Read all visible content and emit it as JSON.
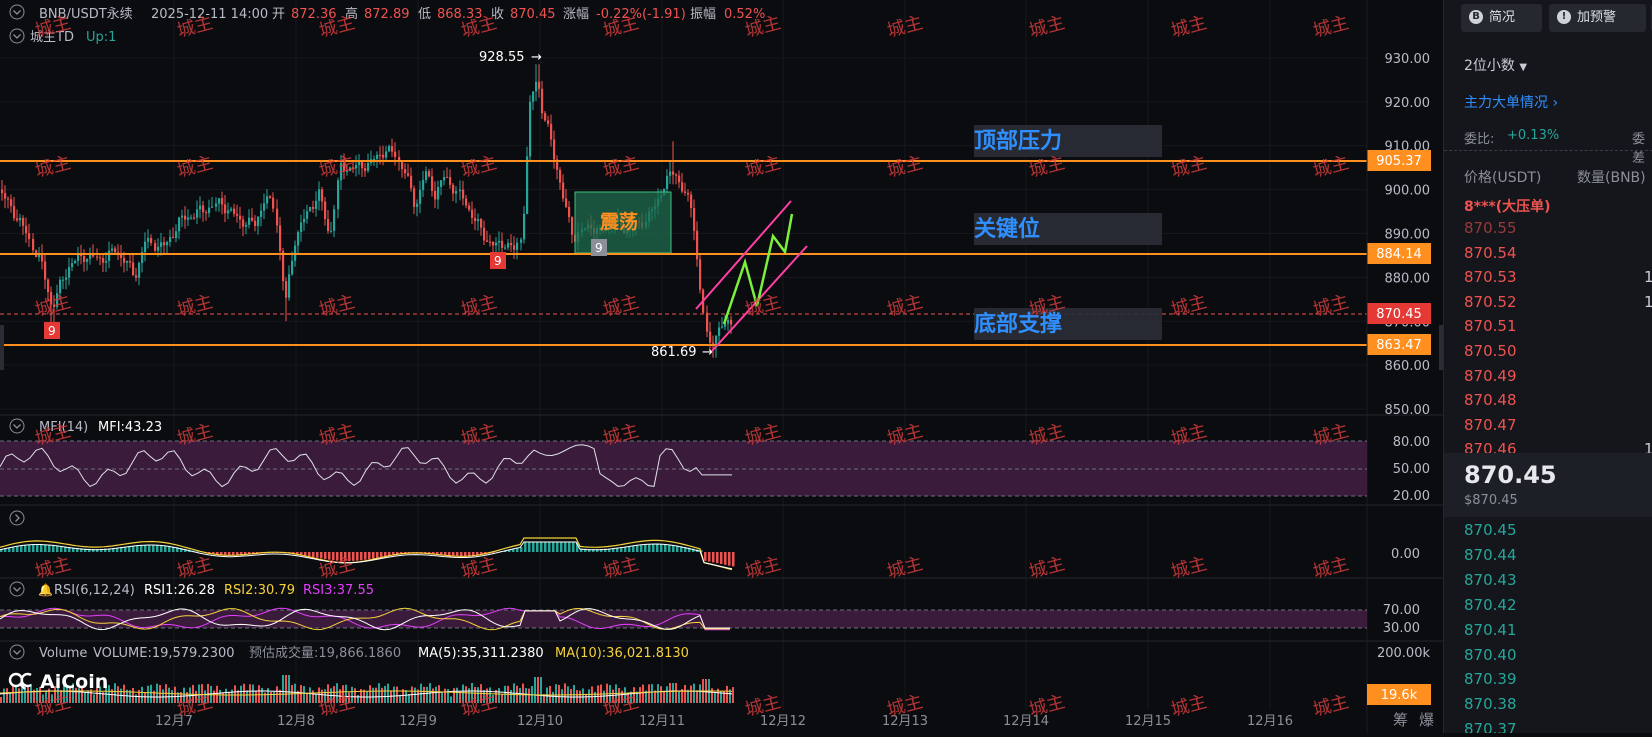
{
  "header": {
    "symbol": "BNB/USDT永续",
    "datetime": "2025-12-11 14:00",
    "open_label": "开",
    "open": "872.36",
    "high_label": "高",
    "high": "872.89",
    "low_label": "低",
    "low": "868.33",
    "close_label": "收",
    "close": "870.45",
    "change_label": "涨幅",
    "change": "-0.22%(-1.91)",
    "amp_label": "振幅",
    "amp": "0.52%",
    "indicator_name": "城主TD",
    "indicator_value": "Up:1"
  },
  "price_axis": [
    "930.00",
    "920.00",
    "910.00",
    "900.00",
    "890.00",
    "880.00",
    "870.00",
    "860.00",
    "850.00"
  ],
  "price_tags": {
    "top": "905.37",
    "key": "884.14",
    "current": "870.45",
    "bottom": "863.47"
  },
  "annotations": {
    "top_zone": "顶部压力",
    "key_zone": "关键位",
    "bottom_zone": "底部支撑",
    "range_box": "震荡",
    "high_label": "928.55",
    "low_label": "861.69",
    "td_count_1": "9",
    "td_count_2": "9",
    "td_count_3": "9"
  },
  "watermark": "城主",
  "mfi": {
    "title": "MFI(14)",
    "value": "MFI:43.23",
    "levels": [
      "80.00",
      "50.00",
      "20.00"
    ]
  },
  "macd": {
    "zero": "0.00"
  },
  "rsi": {
    "title": "RSI(6,12,24)",
    "rsi1": "RSI1:26.28",
    "rsi2": "RSI2:30.79",
    "rsi3": "RSI3:37.55",
    "levels": [
      "70.00",
      "30.00"
    ]
  },
  "volume": {
    "title": "Volume",
    "volume": "VOLUME:19,579.2300",
    "estimate": "预估成交量:19,866.1860",
    "ma5": "MA(5):35,311.2380",
    "ma10": "MA(10):36,021.8130",
    "axis_top": "200.00k",
    "current_tag": "19.6k"
  },
  "logo": "AiCoin",
  "time_axis": [
    "12月7",
    "12月8",
    "12月9",
    "12月10",
    "12月11",
    "12月12",
    "12月13",
    "12月14",
    "12月15",
    "12月16"
  ],
  "bottom_right": [
    "筹",
    "爆"
  ],
  "right_panel": {
    "btn_summary": "简况",
    "btn_alert": "加预警",
    "decimals": "2位小数",
    "big_orders": "主力大单情况",
    "ratio_label": "委比:",
    "ratio_value": "+0.13%",
    "ratio_label2": "委差",
    "col_price": "价格(USDT)",
    "col_qty": "数量(BNB)",
    "big_sell": "8***(大压单)",
    "asks": [
      "870.55",
      "870.54",
      "870.53",
      "870.52",
      "870.51",
      "870.50",
      "870.49",
      "870.48",
      "870.47",
      "870.46"
    ],
    "ask_qty": [
      "",
      "",
      "1",
      "1",
      "",
      "",
      "",
      "",
      "",
      "1"
    ],
    "last_price": "870.45",
    "last_price_usd": "$870.45",
    "bids": [
      "870.45",
      "870.44",
      "870.43",
      "870.42",
      "870.41",
      "870.40",
      "870.39",
      "870.38",
      "870.37"
    ]
  },
  "colors": {
    "up": "#26a69a",
    "down": "#ef5350",
    "orange": "#ff8f1f",
    "zone_text": "#2f8fff",
    "tag_red": "#e53935",
    "rsi2": "#f5d23b",
    "rsi3": "#e040fb",
    "panel_band": "#3b1b3b"
  }
}
